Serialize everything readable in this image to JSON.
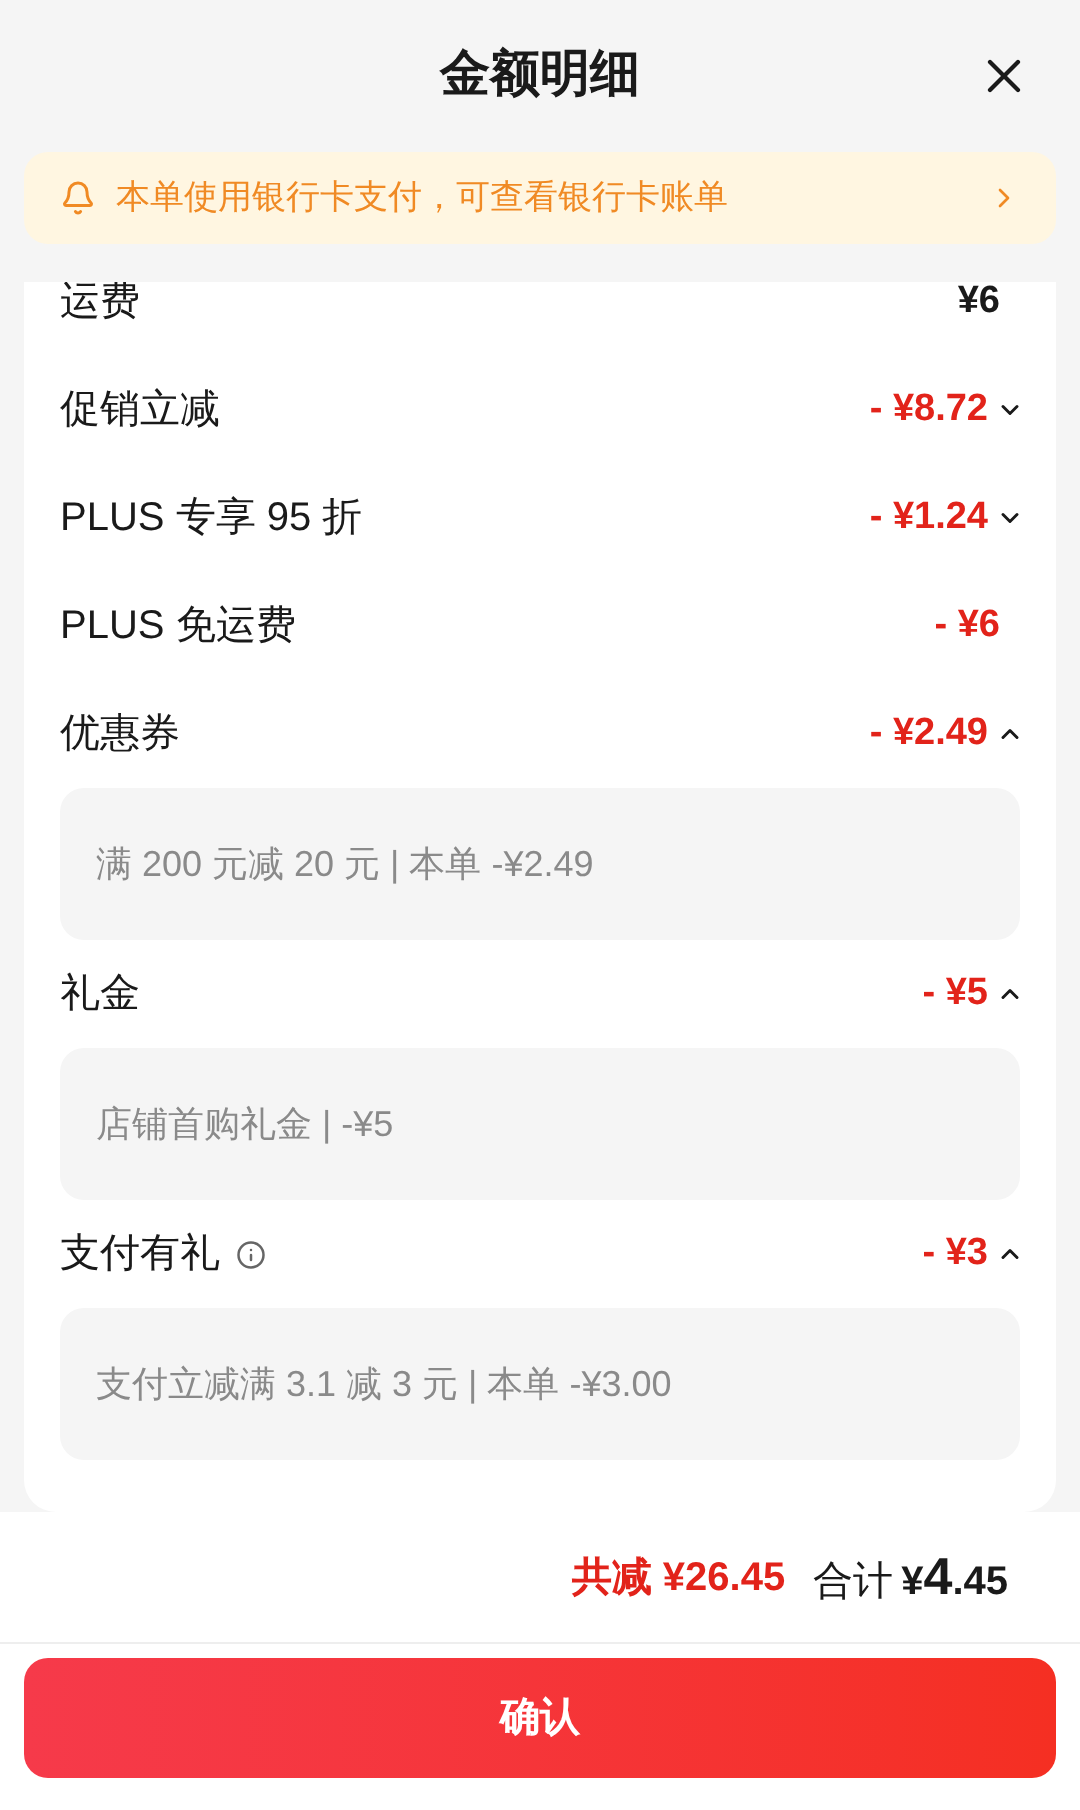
{
  "header": {
    "title": "金额明细"
  },
  "notice": {
    "text": "本单使用银行卡支付，可查看银行卡账单"
  },
  "rows": [
    {
      "kind": "plain",
      "label": "运费",
      "amount": "¥6",
      "negative": false
    },
    {
      "kind": "expandable",
      "label": "促销立减",
      "amount": "- ¥8.72",
      "negative": true,
      "expanded": false
    },
    {
      "kind": "expandable",
      "label": "PLUS 专享 95 折",
      "amount": "- ¥1.24",
      "negative": true,
      "expanded": false
    },
    {
      "kind": "plain",
      "label": "PLUS 免运费",
      "amount": "- ¥6",
      "negative": true
    },
    {
      "kind": "expandable",
      "label": "优惠券",
      "amount": "- ¥2.49",
      "negative": true,
      "expanded": true,
      "detail": "满 200 元减 20 元 | 本单 -¥2.49"
    },
    {
      "kind": "expandable",
      "label": "礼金",
      "amount": "- ¥5",
      "negative": true,
      "expanded": true,
      "detail": "店铺首购礼金 | -¥5"
    },
    {
      "kind": "expandable",
      "label": "支付有礼",
      "info": true,
      "amount": "- ¥3",
      "negative": true,
      "expanded": true,
      "detail": "支付立减满 3.1 减 3 元 | 本单 -¥3.00"
    }
  ],
  "summary": {
    "saved": "共减 ¥26.45",
    "total_label": "合计",
    "total_currency": "¥",
    "total_integer": "4",
    "total_decimal": ".45"
  },
  "confirm_button": "确认"
}
